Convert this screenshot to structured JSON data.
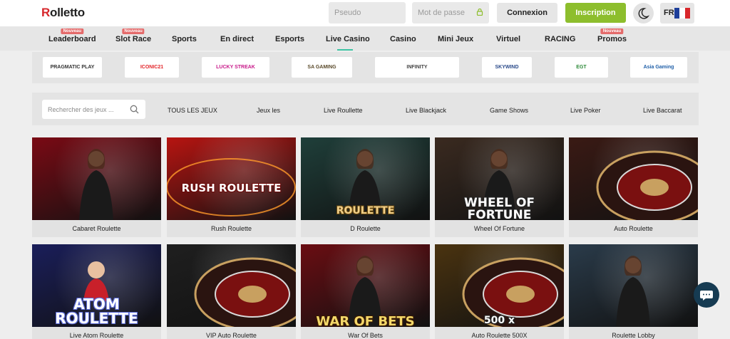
{
  "header": {
    "logo_first": "R",
    "logo_rest": "olletto",
    "pseudo_placeholder": "Pseudo",
    "password_placeholder": "Mot de passe",
    "login_label": "Connexion",
    "signup_label": "Inscription",
    "theme_icon": "moon-icon",
    "lang_code": "FR",
    "lang_flag": "france-flag-icon"
  },
  "nav": {
    "items": [
      {
        "label": "Leaderboard",
        "badge": "Nouveau"
      },
      {
        "label": "Slot Race",
        "badge": "Nouveau"
      },
      {
        "label": "Sports",
        "badge": ""
      },
      {
        "label": "En direct",
        "badge": ""
      },
      {
        "label": "Esports",
        "badge": ""
      },
      {
        "label": "Live Casino",
        "badge": ""
      },
      {
        "label": "Casino",
        "badge": ""
      },
      {
        "label": "Mini Jeux",
        "badge": ""
      },
      {
        "label": "Virtuel",
        "badge": ""
      },
      {
        "label": "RACING",
        "badge": ""
      },
      {
        "label": "Promos",
        "badge": "Nouveau"
      }
    ],
    "active": "Live Casino"
  },
  "providers": [
    {
      "name": "PRAGMATIC PLAY",
      "color": "#333333"
    },
    {
      "name": "ICONIC21",
      "color": "#e3262b"
    },
    {
      "name": "LUCKY STREAK",
      "color": "#c81a8a"
    },
    {
      "name": "SA GAMING",
      "color": "#5a4a2a"
    },
    {
      "name": "INFINITY",
      "color": "#444444"
    },
    {
      "name": "SKYWIND",
      "color": "#2a4a8a"
    },
    {
      "name": "EGT",
      "color": "#2e8b3a"
    },
    {
      "name": "Asia Gaming",
      "color": "#1f5fa8"
    }
  ],
  "filters": {
    "search_placeholder": "Rechercher des jeux ...",
    "categories": [
      "TOUS LES JEUX",
      "Jeux les",
      "Live Roullette",
      "Live Blackjack",
      "Game Shows",
      "Live Poker",
      "Live Baccarat"
    ]
  },
  "games": [
    {
      "name": "Cabaret Roulette",
      "art": "",
      "bg": "#7a0a14"
    },
    {
      "name": "Rush Roulette",
      "art": "RUSH ROULETTE",
      "bg": "#b71411"
    },
    {
      "name": "D Roulette",
      "art": "ROULETTE",
      "bg": "#1f3f3a"
    },
    {
      "name": "Wheel Of Fortune",
      "art": "WHEEL OF FORTUNE",
      "bg": "#3a2a20"
    },
    {
      "name": "Auto Roulette",
      "art": "",
      "bg": "#3a1a14"
    },
    {
      "name": "Live Atom Roulette",
      "art": "ATOM ROULETTE",
      "bg": "#1a1e5a"
    },
    {
      "name": "VIP Auto Roulette",
      "art": "",
      "bg": "#1f1f1f"
    },
    {
      "name": "War Of Bets",
      "art": "WAR OF BETS",
      "bg": "#6a0d12"
    },
    {
      "name": "Auto Roulette 500X",
      "art": "500 x",
      "bg": "#4a3310"
    },
    {
      "name": "Roulette Lobby",
      "art": "",
      "bg": "#2a3b4a"
    }
  ],
  "chat_icon": "chat-bubble-icon"
}
